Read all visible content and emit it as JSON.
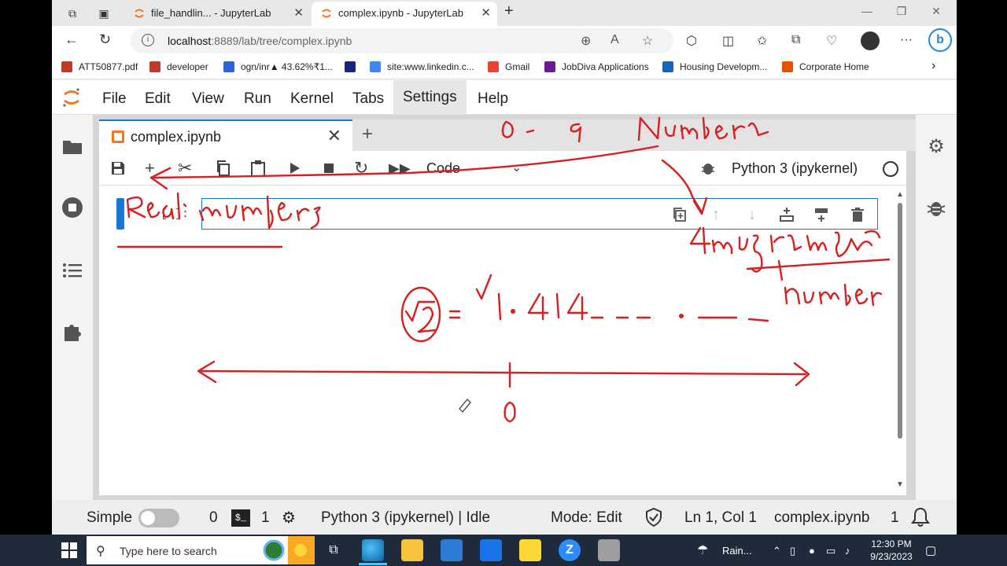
{
  "browser": {
    "tabs": [
      {
        "title": "file_handlin... - JupyterLab",
        "active": false
      },
      {
        "title": "complex.ipynb - JupyterLab",
        "active": true
      }
    ],
    "url_host": "localhost",
    "url_path": ":8889/lab/tree/complex.ipynb",
    "bookmarks": [
      {
        "label": "ATT50877.pdf",
        "color": "#c0392b"
      },
      {
        "label": "developer",
        "color": "#c0392b"
      },
      {
        "label": "ogn/inr▲ 43.62%₹1...",
        "color": "#2d64d6"
      },
      {
        "label": "",
        "color": "#1a237e"
      },
      {
        "label": "site:www.linkedin.c...",
        "color": "#4285f4"
      },
      {
        "label": "Gmail",
        "color": "#ea4335"
      },
      {
        "label": "JobDiva Applications",
        "color": "#6a1b9a"
      },
      {
        "label": "Housing Developm...",
        "color": "#1565c0"
      },
      {
        "label": "Corporate Home",
        "color": "#e65100"
      }
    ]
  },
  "jupyter": {
    "menu": [
      "File",
      "Edit",
      "View",
      "Run",
      "Kernel",
      "Tabs",
      "Settings",
      "Help"
    ],
    "highlighted_menu": "Settings",
    "doc_tab": "complex.ipynb",
    "cell_type": "Code",
    "kernel_name": "Python 3 (ipykernel)",
    "cell_prompt": "[ ]:",
    "status": {
      "mode_label": "Simple",
      "terminals": "0",
      "kernels": "1",
      "kernel_state": "Python 3 (ipykernel) | Idle",
      "edit_mode": "Mode: Edit",
      "cursor": "Ln 1, Col 1",
      "file": "complex.ipynb",
      "notifications": "1"
    }
  },
  "annotations": {
    "top_text": "0 - 9 Number",
    "real_text": "Real numbers",
    "imaginary_text": "Imaginary",
    "imaginary_number_text": "number",
    "sqrt_text": "√2 = 1.414_ __ . __ _",
    "zero_label": "0"
  },
  "taskbar": {
    "search_placeholder": "Type here to search",
    "weather": "Rain...",
    "time": "12:30 PM",
    "date": "9/23/2023"
  }
}
